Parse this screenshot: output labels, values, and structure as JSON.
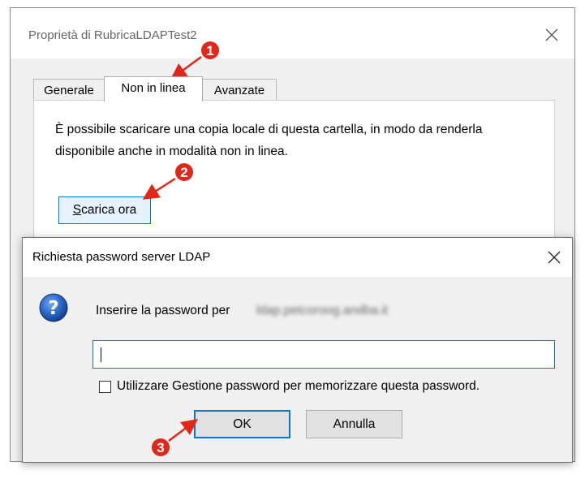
{
  "properties_dialog": {
    "title": "Proprietà di RubricaLDAPTest2",
    "tabs": [
      {
        "label": "Generale",
        "active": false
      },
      {
        "label": "Non in linea",
        "active": true
      },
      {
        "label": "Avanzate",
        "active": false
      }
    ],
    "description": "È possibile scaricare una copia locale di questa cartella, in modo da renderla disponibile anche in modalità non in linea.",
    "download_button": {
      "mnemonic": "S",
      "rest": "carica ora"
    },
    "close_icon": "close-icon"
  },
  "password_dialog": {
    "title": "Richiesta password server LDAP",
    "prompt": "Inserire la password per",
    "server_blurred": "ldap.petcoroog.andba.it",
    "password_value": "",
    "remember_label": "Utilizzare Gestione password per memorizzare questa password.",
    "remember_checked": false,
    "ok_label": "OK",
    "cancel_label": "Annulla",
    "question_icon": "question-icon",
    "close_icon": "close-icon"
  },
  "annotations": {
    "markers": [
      "1",
      "2",
      "3"
    ],
    "color": "#e0271a"
  },
  "colors": {
    "accent": "#0078d7",
    "dialog_bg": "#f0f0f0",
    "annotation": "#e0271a"
  }
}
